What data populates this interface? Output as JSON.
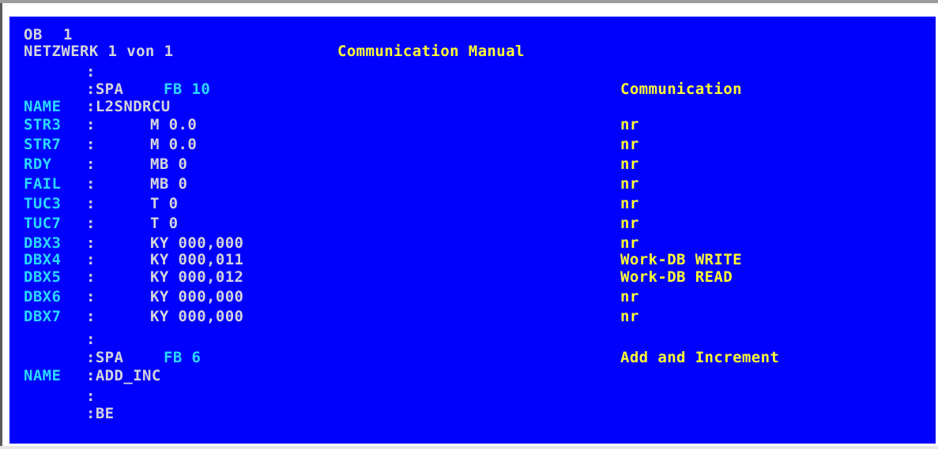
{
  "header": {
    "ob_label": "OB",
    "ob_number": "1",
    "network": "NETZWERK 1 von 1",
    "title": "Communication Manual"
  },
  "lines": [
    {
      "sep": ":",
      "text": "",
      "comment": ""
    },
    {
      "sep": ":SPA",
      "op": "FB 10",
      "comment": "Communication"
    },
    {
      "label": "NAME",
      "sep": ":L2SNDRCU"
    },
    {
      "label": "STR3",
      "sep": ":",
      "text": "M 0.0",
      "comment": "nr"
    },
    {
      "label": "STR7",
      "sep": ":",
      "text": "M 0.0",
      "comment": "nr"
    },
    {
      "label": "RDY",
      "sep": ":",
      "text": "MB 0",
      "comment": "nr"
    },
    {
      "label": "FAIL",
      "sep": ":",
      "text": "MB 0",
      "comment": "nr"
    },
    {
      "label": "TUC3",
      "sep": ":",
      "text": "T 0",
      "comment": "nr"
    },
    {
      "label": "TUC7",
      "sep": ":",
      "text": "T 0",
      "comment": "nr"
    },
    {
      "label": "DBX3",
      "sep": ":",
      "text": "KY 000,000",
      "comment": "nr"
    },
    {
      "label": "DBX4",
      "sep": ":",
      "text": "KY 000,011",
      "comment": "Work-DB WRITE"
    },
    {
      "label": "DBX5",
      "sep": ":",
      "text": "KY 000,012",
      "comment": "Work-DB READ"
    },
    {
      "label": "DBX6",
      "sep": ":",
      "text": "KY 000,000",
      "comment": "nr"
    },
    {
      "label": "DBX7",
      "sep": ":",
      "text": "KY 000,000",
      "comment": "nr"
    },
    {
      "sep": ":"
    },
    {
      "sep": ":SPA",
      "op": "FB 6",
      "comment": "Add and Increment"
    },
    {
      "label": "NAME",
      "sep": ":ADD_INC"
    },
    {
      "sep": ":"
    },
    {
      "sep": ":BE"
    }
  ],
  "colors": {
    "background": "#0000fd",
    "default_text": "#dcdcdc",
    "labels": "#29d8ff",
    "comments": "#ffff33"
  }
}
